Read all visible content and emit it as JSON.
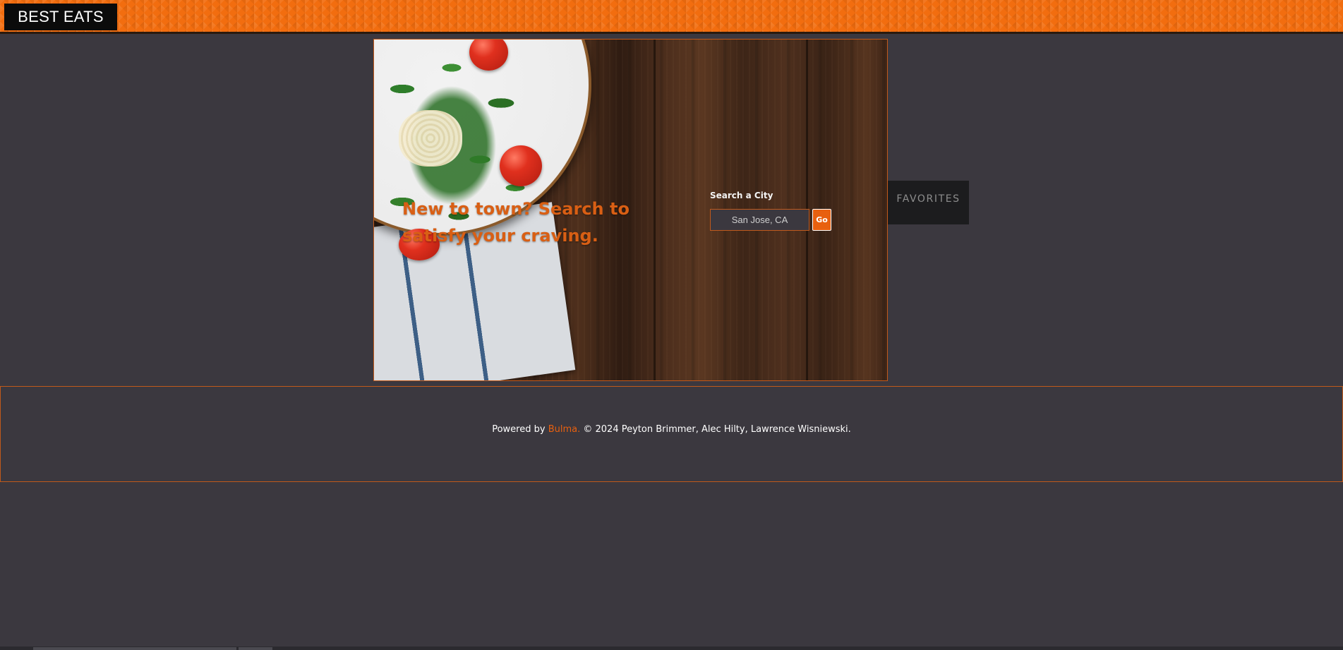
{
  "navbar": {
    "brand": "BEST EATS"
  },
  "hero": {
    "headline": "New to town? Search to satisfy your craving.",
    "search": {
      "label": "Search a City",
      "placeholder": "San Jose, CA",
      "value": "",
      "button_label": "Go"
    }
  },
  "side_panel": {
    "favorites_label": "FAVORITES"
  },
  "footer": {
    "prefix": "Powered by ",
    "link_text": "Bulma.",
    "suffix": " © 2024 Peyton Brimmer, Alec Hilty, Lawrence Wisniewski."
  },
  "colors": {
    "accent": "#e8600f",
    "background": "#3b383f",
    "navbar": "#f26d0f"
  }
}
